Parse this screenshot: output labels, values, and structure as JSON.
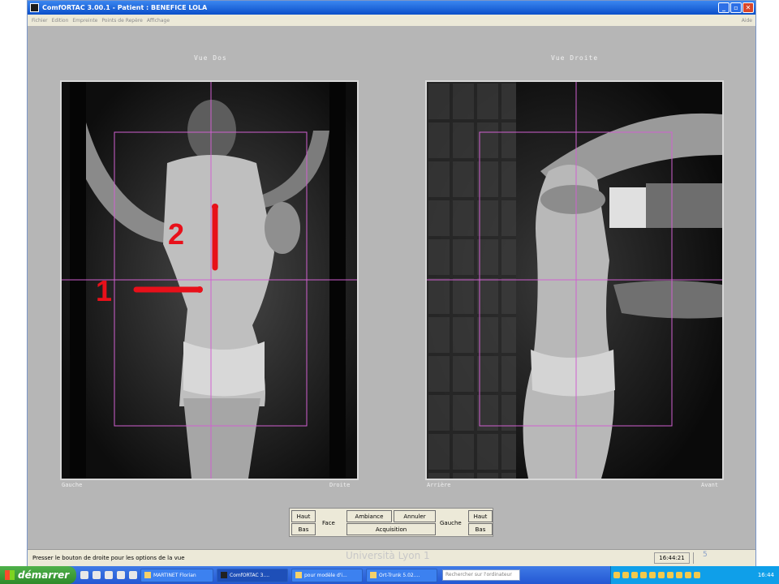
{
  "window": {
    "title": "ComfORTAC 3.00.1  -  Patient : BENEFICE LOLA"
  },
  "menu": {
    "items": [
      "Fichier",
      "Edition",
      "Empreinte",
      "Points de Repère",
      "Affichage"
    ],
    "help": "Aide"
  },
  "views": {
    "left": {
      "title": "Vue Dos",
      "corner_left": "Gauche",
      "corner_right": "Droite"
    },
    "right": {
      "title": "Vue Droite",
      "corner_left": "Arrière",
      "corner_right": "Avant"
    }
  },
  "annotations": {
    "marker1": "1",
    "marker2": "2"
  },
  "controls": {
    "haut_left": "Haut",
    "bas_left": "Bas",
    "face": "Face",
    "ambiance": "Ambiance",
    "annuler": "Annuler",
    "acquisition": "Acquisition",
    "gauche": "Gauche",
    "haut_right": "Haut",
    "bas_right": "Bas"
  },
  "status": {
    "text": "Presser le bouton de droite pour les options de la vue",
    "time": "16:44:21"
  },
  "overlay": {
    "university": "Università Lyon 1",
    "slide_number": "5"
  },
  "taskbar": {
    "start": "démarrer",
    "tasks": [
      "MARTINET Florian",
      "ComfORTAC 3....",
      "pour modèle d'i...",
      "Ort-Trunk 5.02...."
    ],
    "search_placeholder": "Rechercher sur l'ordinateur",
    "clock": "16:44"
  },
  "colors": {
    "guide": "#d060d0",
    "annotation": "#e8101a",
    "titlebar": "#0b4fc9"
  }
}
